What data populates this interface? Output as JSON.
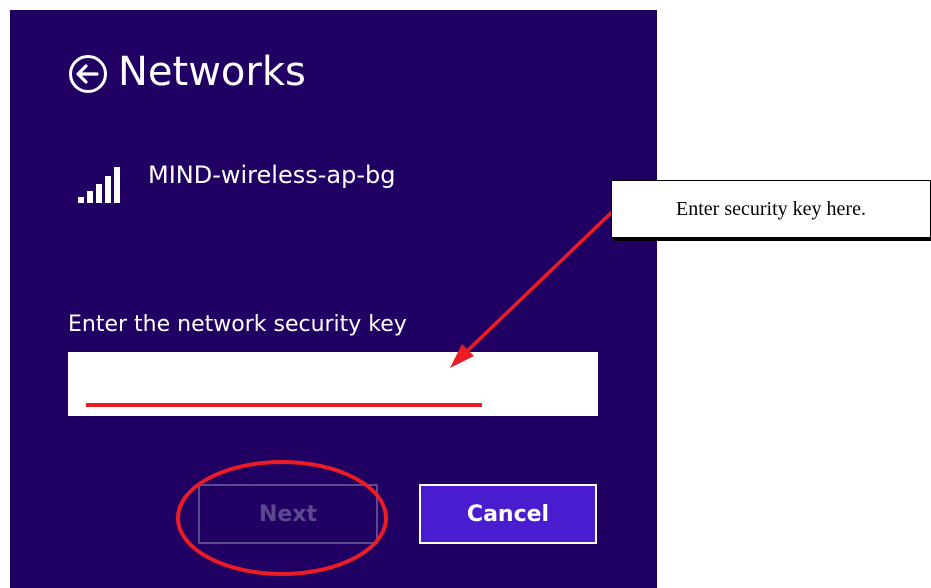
{
  "header": {
    "title": "Networks",
    "back_icon": "back-arrow-circle-icon"
  },
  "network": {
    "name": "MIND-wireless-ap-bg",
    "signal_icon": "wifi-signal-strength-icon",
    "signal_bars": 5
  },
  "security_key": {
    "label": "Enter the network security key",
    "value": "",
    "placeholder": ""
  },
  "buttons": {
    "next_label": "Next",
    "next_enabled": false,
    "cancel_label": "Cancel"
  },
  "annotation": {
    "callout_text": "Enter security key here.",
    "markup_color": "#ec1c24"
  },
  "colors": {
    "panel_background": "#200063",
    "cancel_button_fill": "#4a1cd0",
    "disabled_button": "#5c4a8f"
  }
}
